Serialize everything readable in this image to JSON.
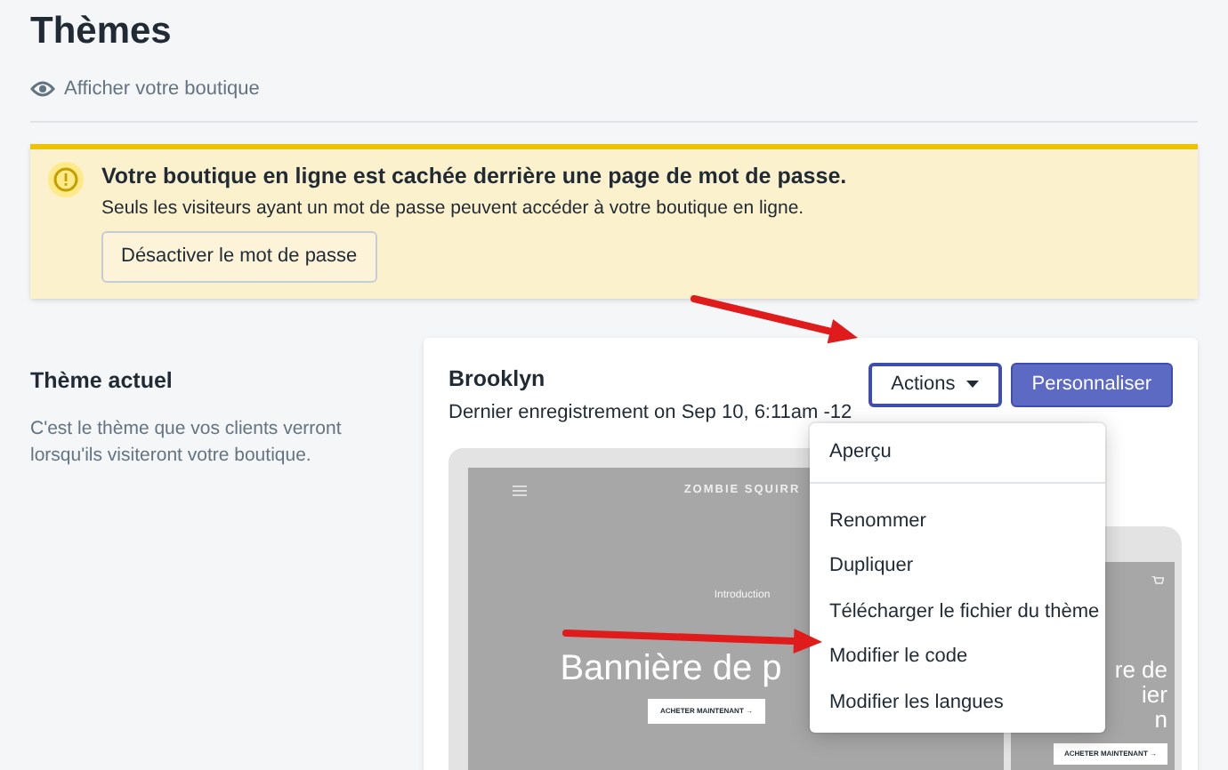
{
  "page": {
    "title": "Thèmes",
    "view_store_link": "Afficher votre boutique"
  },
  "banner": {
    "title": "Votre boutique en ligne est cachée derrière une page de mot de passe.",
    "text": "Seuls les visiteurs ayant un mot de passe peuvent accéder à votre boutique en ligne.",
    "button": "Désactiver le mot de passe"
  },
  "section": {
    "title": "Thème actuel",
    "description": "C'est le thème que vos clients verront lorsqu'ils visiteront votre boutique."
  },
  "theme": {
    "name": "Brooklyn",
    "saved": "Dernier enregistrement on Sep 10, 6:11am -12",
    "actions_button": "Actions",
    "customize_button": "Personnaliser"
  },
  "actions_menu": {
    "expanded": true,
    "groups": [
      [
        "Aperçu"
      ],
      [
        "Renommer",
        "Dupliquer",
        "Télécharger le fichier du thème",
        "Modifier le code",
        "Modifier les langues"
      ]
    ]
  },
  "preview": {
    "store_name": "ZOMBIE SQUIRR",
    "eyebrow": "Introduction",
    "heading": "Bannière de p",
    "button": "ACHETER MAINTENANT →",
    "mobile_heading_lines": [
      "re de",
      "ier",
      "n"
    ],
    "mobile_button": "ACHETER MAINTENANT →"
  }
}
